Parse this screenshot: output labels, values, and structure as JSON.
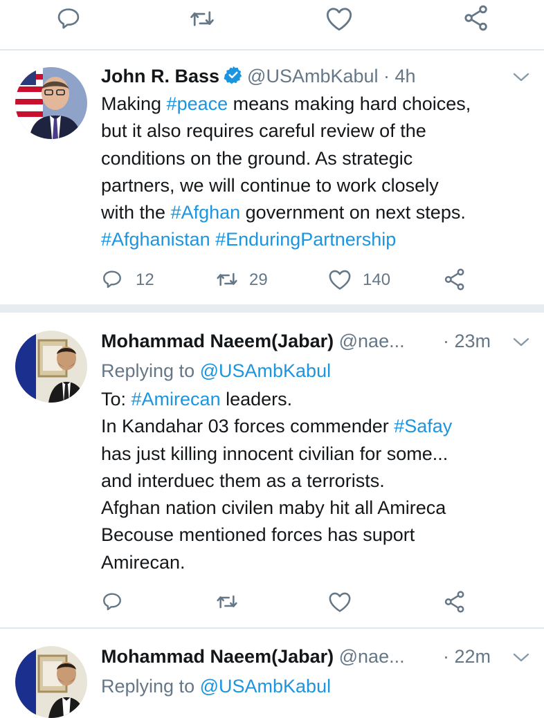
{
  "colors": {
    "accent": "#1b95e0",
    "text": "#14171a",
    "secondary": "#657786",
    "divider": "#e1e8ed"
  },
  "top_action_bar": {
    "icons": [
      "reply-icon",
      "retweet-icon",
      "like-icon",
      "share-icon"
    ]
  },
  "tweets": [
    {
      "name": "John R. Bass",
      "verified": true,
      "handle": "@USAmbKabul",
      "time": " · 4h",
      "lines": [
        [
          {
            "t": "Making "
          },
          {
            "t": "#peace",
            "link": true
          },
          {
            "t": " means making hard choices,"
          }
        ],
        [
          {
            "t": "but it also requires careful review of the"
          }
        ],
        [
          {
            "t": "conditions on the ground. As strategic"
          }
        ],
        [
          {
            "t": "partners, we will continue to work closely"
          }
        ],
        [
          {
            "t": "with the "
          },
          {
            "t": "#Afghan",
            "link": true
          },
          {
            "t": " government on next steps."
          }
        ],
        [
          {
            "t": "#Afghanistan",
            "link": true
          },
          {
            "t": " "
          },
          {
            "t": "#EnduringPartnership",
            "link": true
          }
        ]
      ],
      "actions": {
        "replies": "12",
        "retweets": "29",
        "likes": "140"
      }
    },
    {
      "name": "Mohammad Naeem(Jabar)",
      "handle": "@nae...",
      "time": "· 23m",
      "replying_prefix": "Replying to ",
      "replying_to": "@USAmbKabul",
      "lines": [
        [
          {
            "t": "To: "
          },
          {
            "t": "#Amirecan",
            "link": true
          },
          {
            "t": " leaders."
          }
        ],
        [
          {
            "t": "In Kandahar 03 forces commender "
          },
          {
            "t": "#Safay",
            "link": true
          }
        ],
        [
          {
            "t": "has just killing innocent civilian for some..."
          }
        ],
        [
          {
            "t": "and interduec them as a terrorists."
          }
        ],
        [
          {
            "t": "Afghan nation civilen maby hit all Amireca"
          }
        ],
        [
          {
            "t": "Becouse mentioned forces has suport"
          }
        ],
        [
          {
            "t": "Amirecan."
          }
        ]
      ]
    },
    {
      "name": "Mohammad Naeem(Jabar)",
      "handle": "@nae...",
      "time": "· 22m",
      "replying_prefix": "Replying to ",
      "replying_to": "@USAmbKabul"
    }
  ]
}
